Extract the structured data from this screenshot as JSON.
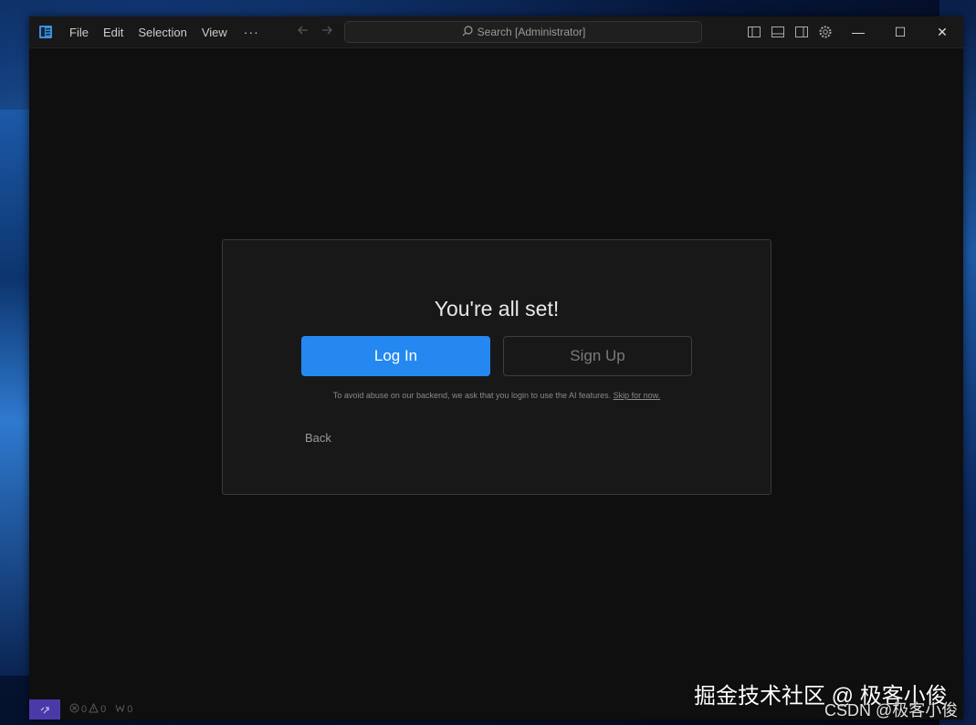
{
  "menu": {
    "file": "File",
    "edit": "Edit",
    "selection": "Selection",
    "view": "View",
    "more": "···"
  },
  "search": {
    "label": "Search [Administrator]"
  },
  "window_controls": {
    "minimize": "—",
    "maximize": "☐",
    "close": "✕"
  },
  "dialog": {
    "title": "You're all set!",
    "login_label": "Log In",
    "signup_label": "Sign Up",
    "notice_text": "To avoid abuse on our backend, we ask that you login to use the AI features.",
    "skip_label": "Skip for now.",
    "back_label": "Back"
  },
  "statusbar": {
    "errors": "0",
    "warnings": "0",
    "ports": "0"
  },
  "watermark": {
    "line1": "掘金技术社区 @ 极客小俊",
    "line2": "CSDN @极客小俊"
  },
  "colors": {
    "accent": "#2488f0",
    "window_bg": "#0f0f0f",
    "dialog_bg": "#181818",
    "remote": "#4a3aa8"
  }
}
